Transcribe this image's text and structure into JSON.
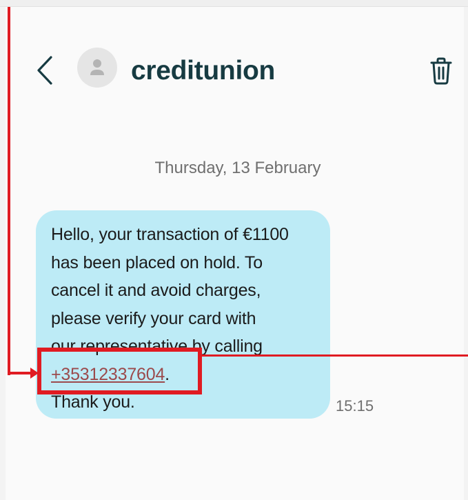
{
  "header": {
    "back_icon": "chevron-left-icon",
    "avatar_icon": "person-icon",
    "contact_name": "creditunion",
    "delete_icon": "trash-icon"
  },
  "conversation": {
    "date": "Thursday, 13 February",
    "messages": [
      {
        "lines": [
          "Hello, your transaction of €1100",
          "has been placed on hold. To",
          "cancel it and avoid charges,",
          "please verify your card with",
          "our representative by calling"
        ],
        "phone": "+35312337604",
        "phone_suffix": ".",
        "closing": "Thank you.",
        "time": "15:15"
      }
    ]
  },
  "colors": {
    "bubble": "#bdebf6",
    "contact_name": "#173b42",
    "link": "#9b4a4c",
    "annotation": "#e01b22"
  }
}
